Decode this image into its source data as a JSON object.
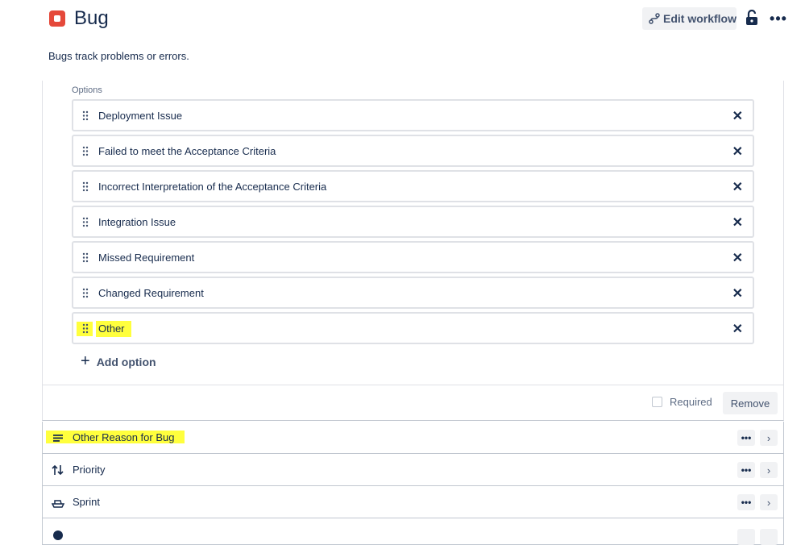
{
  "header": {
    "title": "Bug",
    "edit_workflow_label": "Edit workflow",
    "more_label": "•••"
  },
  "description": "Bugs track problems or errors.",
  "options_section": {
    "label": "Options",
    "options": [
      {
        "label": "Deployment Issue",
        "remove": "✕"
      },
      {
        "label": "Failed to meet the Acceptance Criteria",
        "remove": "✕"
      },
      {
        "label": "Incorrect Interpretation of the Acceptance Criteria",
        "remove": "✕"
      },
      {
        "label": "Integration Issue",
        "remove": "✕"
      },
      {
        "label": "Missed Requirement",
        "remove": "✕"
      },
      {
        "label": "Changed Requirement",
        "remove": "✕"
      },
      {
        "label": "Other",
        "remove": "✕"
      }
    ],
    "add_option_label": "Add option"
  },
  "footer": {
    "required_label": "Required",
    "remove_label": "Remove"
  },
  "fields": [
    {
      "label": "Other Reason for Bug",
      "icon": "paragraph-lines-icon"
    },
    {
      "label": "Priority",
      "icon": "priority-arrows-icon"
    },
    {
      "label": "Sprint",
      "icon": "sprint-boat-icon"
    }
  ],
  "colors": {
    "bug_red": "#e5493a",
    "highlight": "#ffff3d",
    "text_primary": "#172b4d",
    "button_bg": "#f1f2f4"
  }
}
